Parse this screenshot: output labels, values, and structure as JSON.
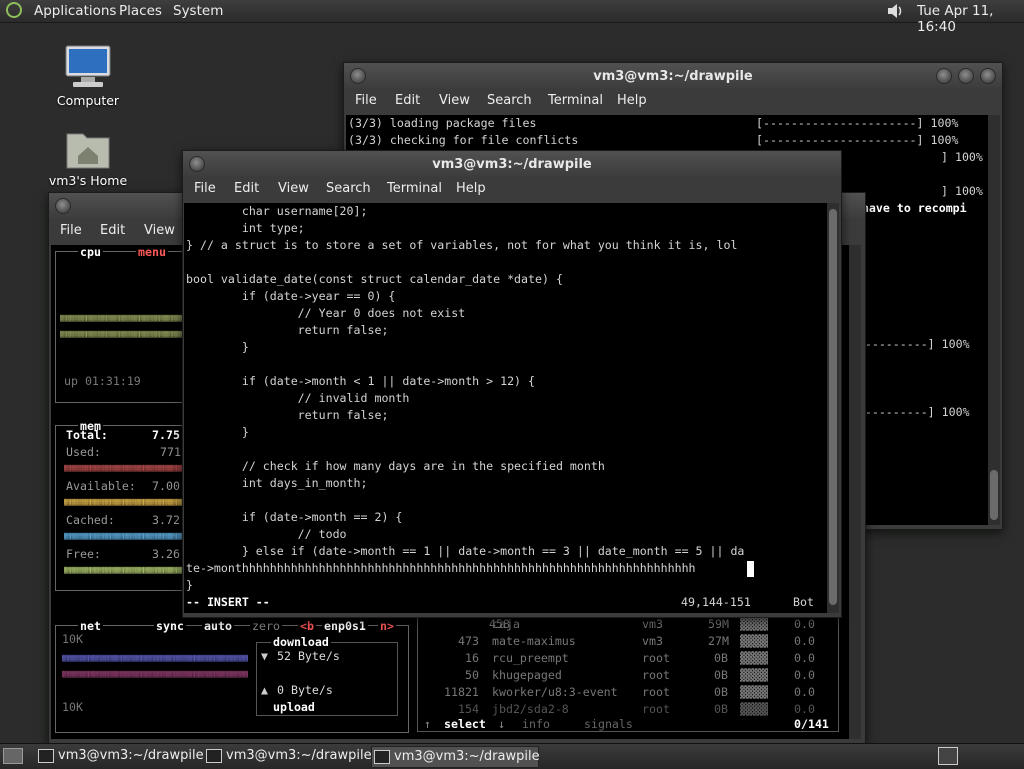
{
  "top_panel": {
    "menus": [
      "Applications",
      "Places",
      "System"
    ],
    "clock": "Tue Apr 11, 16:40"
  },
  "desktop_icons": [
    {
      "label": "Computer"
    },
    {
      "label": "vm3's Home"
    }
  ],
  "back_terminal": {
    "title": "vm3@vm3:~/drawpile",
    "menu": [
      "File",
      "Edit",
      "View",
      "Search",
      "Terminal",
      "Help"
    ],
    "lines": [
      {
        "left": "(3/3) loading package files",
        "bar": "[----------------------] 100%"
      },
      {
        "left": "(3/3) checking for file conflicts",
        "bar": "[----------------------] 100%"
      },
      {
        "left": "",
        "bar": "] 100%"
      },
      {
        "left": "",
        "bar": "] 100%"
      },
      {
        "left": "",
        "bar": "ay have to recompi"
      },
      {
        "left": "",
        "bar": "----------------] 100%"
      },
      {
        "left": "",
        "bar": "----------------] 100%"
      }
    ]
  },
  "btop": {
    "menu": [
      "File",
      "Edit",
      "View"
    ],
    "cpu": {
      "title": "cpu",
      "menu": "menu",
      "uptime": "up 01:31:19"
    },
    "mem": {
      "title": "mem",
      "rows": [
        {
          "label": "Total:",
          "value": "7.75"
        },
        {
          "label": "Used:",
          "value": "771"
        },
        {
          "label": "Available:",
          "value": "7.00"
        },
        {
          "label": "Cached:",
          "value": "3.72"
        },
        {
          "label": "Free:",
          "value": "3.26"
        }
      ]
    },
    "net": {
      "title": "net",
      "sync": "sync",
      "auto": "auto",
      "zero": "zero",
      "iface_prev": "<b",
      "iface": "enp0s1",
      "iface_next": "n>",
      "top_scale": "10K",
      "bottom_scale": "10K",
      "download_label": "download",
      "download_rate": "52 Byte/s",
      "upload_rate": "0 Byte/s",
      "upload_label": "upload"
    },
    "procs": [
      {
        "pid": "458",
        "name": "caja",
        "user": "vm3",
        "mem": "59M",
        "cpu": "0.0"
      },
      {
        "pid": "473",
        "name": "mate-maximus",
        "user": "vm3",
        "mem": "27M",
        "cpu": "0.0"
      },
      {
        "pid": "16",
        "name": "rcu_preempt",
        "user": "root",
        "mem": "0B",
        "cpu": "0.0"
      },
      {
        "pid": "50",
        "name": "khugepaged",
        "user": "root",
        "mem": "0B",
        "cpu": "0.0"
      },
      {
        "pid": "11821",
        "name": "kworker/u8:3-event",
        "user": "root",
        "mem": "0B",
        "cpu": "0.0"
      },
      {
        "pid": "154",
        "name": "jbd2/sda2-8",
        "user": "root",
        "mem": "0B",
        "cpu": "0.0"
      }
    ],
    "footer": {
      "select": "select",
      "info": "info",
      "signals": "signals",
      "count": "0/141"
    }
  },
  "front_terminal": {
    "title": "vm3@vm3:~/drawpile",
    "menu": [
      "File",
      "Edit",
      "View",
      "Search",
      "Terminal",
      "Help"
    ],
    "lines": [
      "        char username[20];",
      "        int type;",
      "} // a struct is to store a set of variables, not for what you think it is, lol",
      "",
      "bool validate_date(const struct calendar_date *date) {",
      "        if (date->year == 0) {",
      "                // Year 0 does not exist",
      "                return false;",
      "        }",
      "",
      "        if (date->month < 1 || date->month > 12) {",
      "                // invalid month",
      "                return false;",
      "        }",
      "",
      "        // check if how many days are in the specified month",
      "        int days_in_month;",
      "",
      "        if (date->month == 2) {",
      "                // todo",
      "        } else if (date->month == 1 || date->month == 3 || date_month == 5 || da",
      "te->monthhhhhhhhhhhhhhhhhhhhhhhhhhhhhhhhhhhhhhhhhhhhhhhhhhhhhhhhhhhhhhhhh",
      "}"
    ],
    "status_mode": "-- INSERT --",
    "status_pos": "49,144-151",
    "status_scroll": "Bot"
  },
  "taskbar": {
    "tasks": [
      "vm3@vm3:~/drawpile",
      "vm3@vm3:~/drawpile",
      "vm3@vm3:~/drawpile"
    ]
  },
  "colors": {
    "accent": "#d14545",
    "terminal_bg": "#000000",
    "panel": "#3a3b3a"
  }
}
